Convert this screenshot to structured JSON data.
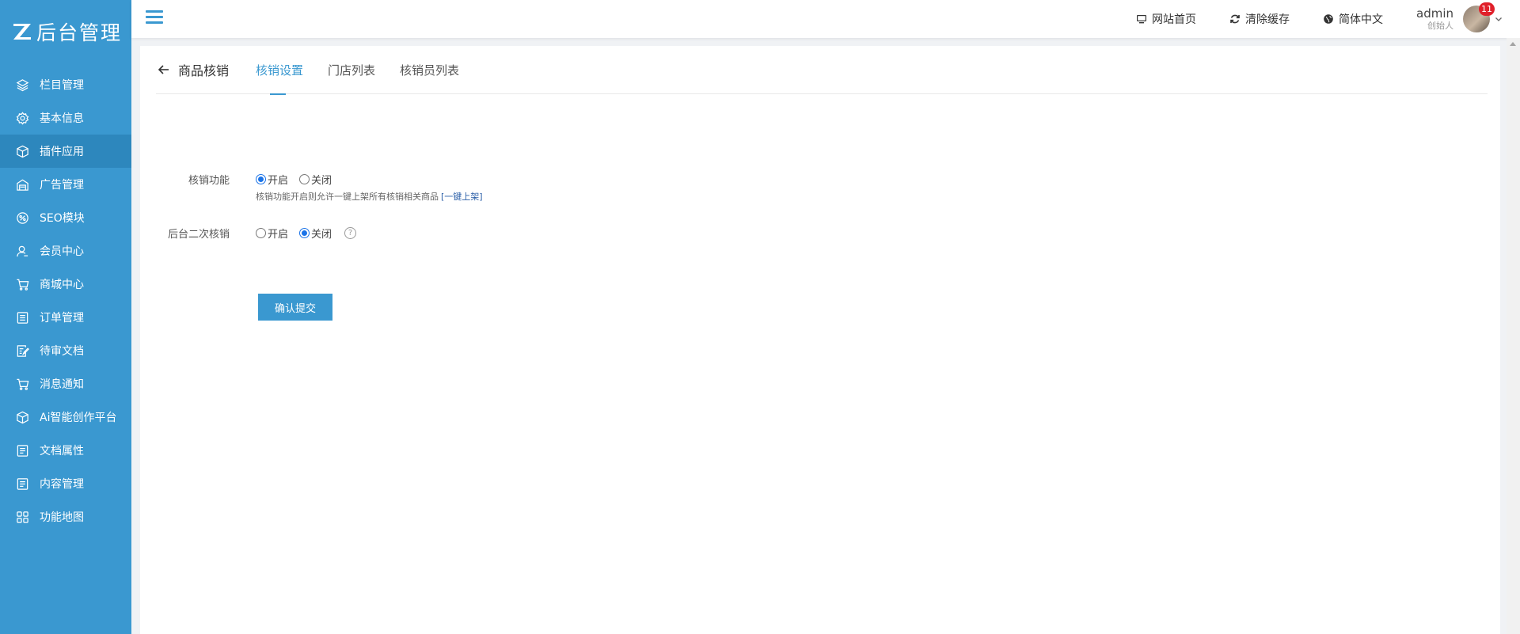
{
  "brand": {
    "logo_text": "后台管理"
  },
  "sidebar": {
    "items": [
      {
        "label": "栏目管理",
        "icon": "layers-icon"
      },
      {
        "label": "基本信息",
        "icon": "gear-icon"
      },
      {
        "label": "插件应用",
        "icon": "cube-icon",
        "active": true
      },
      {
        "label": "广告管理",
        "icon": "ad-icon"
      },
      {
        "label": "SEO模块",
        "icon": "seo-icon"
      },
      {
        "label": "会员中心",
        "icon": "user-icon"
      },
      {
        "label": "商城中心",
        "icon": "cart-icon"
      },
      {
        "label": "订单管理",
        "icon": "list-icon"
      },
      {
        "label": "待审文档",
        "icon": "edit-doc-icon"
      },
      {
        "label": "消息通知",
        "icon": "cart-icon"
      },
      {
        "label": "Ai智能创作平台",
        "icon": "cube-icon"
      },
      {
        "label": "文档属性",
        "icon": "doc-icon"
      },
      {
        "label": "内容管理",
        "icon": "doc-icon"
      },
      {
        "label": "功能地图",
        "icon": "grid-icon"
      }
    ]
  },
  "topbar": {
    "site_home": "网站首页",
    "clear_cache": "清除缓存",
    "language": "简体中文",
    "user_name": "admin",
    "user_role": "创始人",
    "notification_count": "11"
  },
  "page": {
    "back_title": "商品核销",
    "tabs": [
      "核销设置",
      "门店列表",
      "核销员列表"
    ],
    "active_tab": 0
  },
  "form": {
    "field1": {
      "label": "核销功能",
      "options": [
        "开启",
        "关闭"
      ],
      "selected": "开启",
      "hint": "核销功能开启则允许一键上架所有核销相关商品",
      "hint_link": "[一键上架]"
    },
    "field2": {
      "label": "后台二次核销",
      "options": [
        "开启",
        "关闭"
      ],
      "selected": "关闭",
      "help": "?"
    },
    "submit_label": "确认提交"
  },
  "colors": {
    "accent": "#3a98d0",
    "badge": "#e0202a"
  }
}
